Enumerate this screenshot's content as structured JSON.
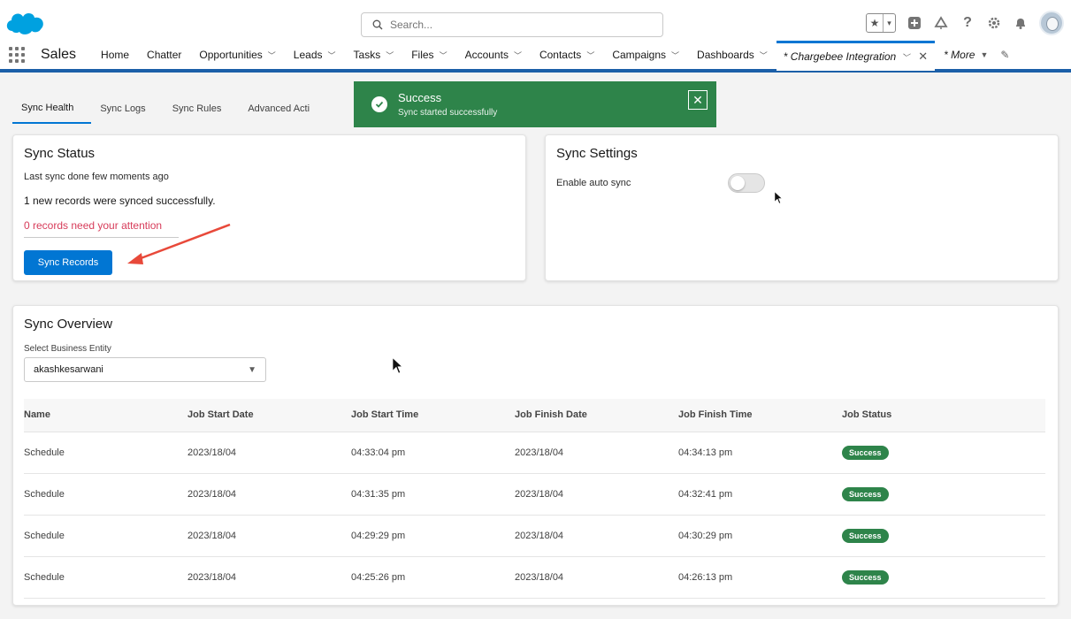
{
  "header": {
    "search_placeholder": "Search..."
  },
  "nav": {
    "app_name": "Sales",
    "items": [
      {
        "label": "Home",
        "dropdown": false
      },
      {
        "label": "Chatter",
        "dropdown": false
      },
      {
        "label": "Opportunities",
        "dropdown": true
      },
      {
        "label": "Leads",
        "dropdown": true
      },
      {
        "label": "Tasks",
        "dropdown": true
      },
      {
        "label": "Files",
        "dropdown": true
      },
      {
        "label": "Accounts",
        "dropdown": true
      },
      {
        "label": "Contacts",
        "dropdown": true
      },
      {
        "label": "Campaigns",
        "dropdown": true
      },
      {
        "label": "Dashboards",
        "dropdown": true
      }
    ],
    "active_tab": "* Chargebee Integration",
    "more": "* More"
  },
  "tabs": [
    "Sync Health",
    "Sync Logs",
    "Sync Rules",
    "Advanced Acti"
  ],
  "toast": {
    "title": "Success",
    "message": "Sync started successfully"
  },
  "sync_status": {
    "title": "Sync Status",
    "last_sync": "Last sync done few moments ago",
    "records": "1 new records were synced successfully.",
    "attention": "0 records need your attention",
    "button": "Sync Records"
  },
  "sync_settings": {
    "title": "Sync Settings",
    "auto_sync_label": "Enable auto sync"
  },
  "overview": {
    "title": "Sync Overview",
    "entity_label": "Select Business Entity",
    "entity_value": "akashkesarwani",
    "columns": [
      "Name",
      "Job Start Date",
      "Job Start Time",
      "Job Finish Date",
      "Job Finish Time",
      "Job Status"
    ],
    "rows": [
      [
        "Schedule",
        "2023/18/04",
        "04:33:04 pm",
        "2023/18/04",
        "04:34:13 pm",
        "Success"
      ],
      [
        "Schedule",
        "2023/18/04",
        "04:31:35 pm",
        "2023/18/04",
        "04:32:41 pm",
        "Success"
      ],
      [
        "Schedule",
        "2023/18/04",
        "04:29:29 pm",
        "2023/18/04",
        "04:30:29 pm",
        "Success"
      ],
      [
        "Schedule",
        "2023/18/04",
        "04:25:26 pm",
        "2023/18/04",
        "04:26:13 pm",
        "Success"
      ]
    ]
  },
  "colors": {
    "brand": "#0176d3",
    "success": "#2e844a",
    "attention": "#d73c5a"
  }
}
